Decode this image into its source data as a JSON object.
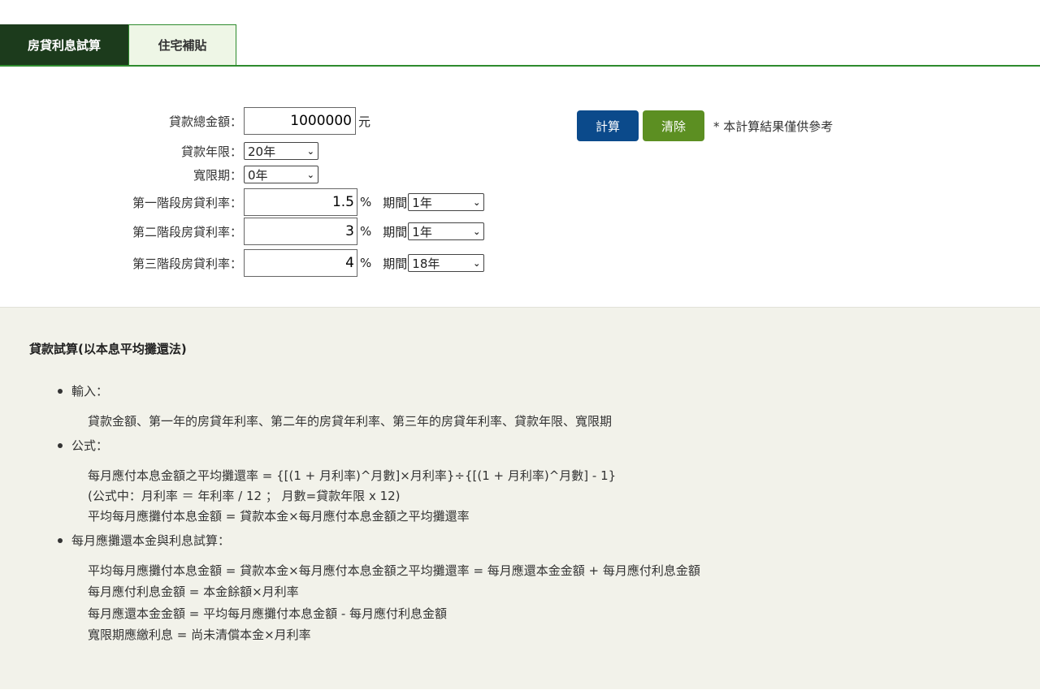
{
  "tabs": {
    "loan_calc": "房貸利息試算",
    "housing_subsidy": "住宅補貼"
  },
  "form": {
    "amount_label": "貸款總金額：",
    "amount_value": "1000000",
    "amount_unit": "元",
    "years_label": "貸款年限：",
    "years_value": "20年",
    "grace_label": "寬限期：",
    "grace_value": "0年",
    "stage1_label": "第一階段房貸利率：",
    "stage1_rate": "1.5",
    "stage2_label": "第二階段房貸利率：",
    "stage2_rate": "3",
    "stage3_label": "第三階段房貸利率：",
    "stage3_rate": "4",
    "percent_unit": "%",
    "period_label": "期間",
    "stage1_period": "1年",
    "stage2_period": "1年",
    "stage3_period": "18年"
  },
  "actions": {
    "calculate": "計算",
    "clear": "清除",
    "note": "* 本計算結果僅供參考"
  },
  "info": {
    "title": "貸款試算(以本息平均攤還法)",
    "input_heading": "輸入：",
    "input_text": "貸款金額、第一年的房貸年利率、第二年的房貸年利率、第三年的房貸年利率、貸款年限、寬限期",
    "formula_heading": "公式：",
    "formula_1": "每月應付本息金額之平均攤還率 = {[(1 + 月利率)^月數]×月利率}÷{[(1 + 月利率)^月數] - 1}",
    "formula_2": "(公式中：月利率 ＝ 年利率 / 12 ； 月數=貸款年限 x 12)",
    "formula_3": "平均每月應攤付本息金額 = 貸款本金×每月應付本息金額之平均攤還率",
    "calc_heading": "每月應攤還本金與利息試算：",
    "calc_1": "平均每月應攤付本息金額 = 貸款本金×每月應付本息金額之平均攤還率 = 每月應還本金金額 + 每月應付利息金額",
    "calc_2": "每月應付利息金額 = 本金餘額×月利率",
    "calc_3": "每月應還本金金額 = 平均每月應攤付本息金額 - 每月應付利息金額",
    "calc_4": "寬限期應繳利息 = 尚未清償本金×月利率"
  }
}
